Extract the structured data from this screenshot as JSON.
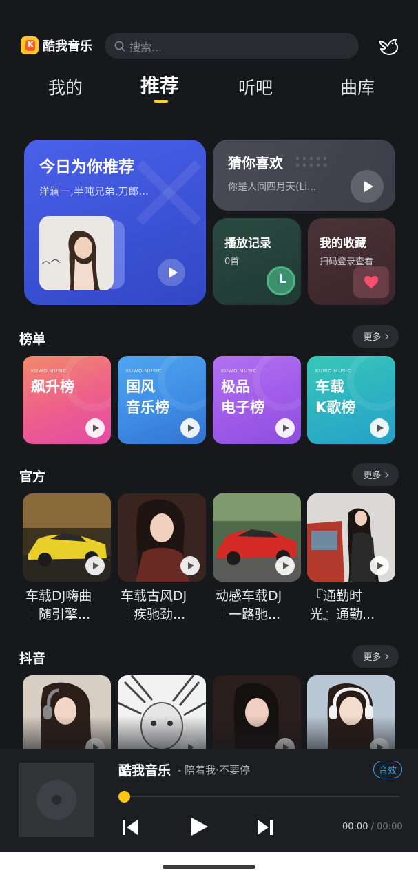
{
  "app": {
    "name": "酷我音乐"
  },
  "search": {
    "placeholder": "搜索..."
  },
  "tabs": [
    {
      "label": "我的"
    },
    {
      "label": "推荐"
    },
    {
      "label": "听吧"
    },
    {
      "label": "曲库"
    }
  ],
  "active_tab": "推荐",
  "feature": {
    "today": {
      "title": "今日为你推荐",
      "subtitle": "洋澜一,半吨兄弟,刀郎..."
    },
    "guess": {
      "title": "猜你喜欢",
      "subtitle": "你是人间四月天(Li..."
    },
    "history": {
      "title": "播放记录",
      "subtitle": "0首"
    },
    "favorites": {
      "title": "我的收藏",
      "subtitle": "扫码登录查看"
    }
  },
  "sections": {
    "charts": {
      "title": "榜单",
      "more": "更多"
    },
    "official": {
      "title": "官方",
      "more": "更多"
    },
    "douyin": {
      "title": "抖音",
      "more": "更多"
    }
  },
  "charts": [
    {
      "tag": "KUWO MUSIC",
      "name": "飙升榜"
    },
    {
      "tag": "KUWO MUSIC",
      "name": "国风\n音乐榜"
    },
    {
      "tag": "KUWO MUSIC",
      "name": "极品\n电子榜"
    },
    {
      "tag": "KUWO MUSIC",
      "name": "车载\nK歌榜"
    }
  ],
  "official_playlists": [
    {
      "title": "车载DJ嗨曲\n｜随引擎..."
    },
    {
      "title": "车载古风DJ\n｜疾驰劲..."
    },
    {
      "title": "动感车载DJ\n｜一路驰..."
    },
    {
      "title": "『通勤时\n光』通勤..."
    }
  ],
  "player": {
    "title": "酷我音乐",
    "subtitle": "- 陪着我·不要停",
    "effect_label": "音效",
    "current_time": "00:00",
    "separator": "/",
    "total_time": "00:00",
    "progress": 0
  },
  "colors": {
    "background": "#17181c",
    "accent_yellow": "#ffd21e",
    "effect_blue": "#3aa7f0"
  },
  "icons": {
    "logo": "kuwo-logo-icon",
    "search": "search-icon",
    "bird": "bird-icon",
    "play": "play-icon",
    "clock": "clock-icon",
    "heart": "heart-icon",
    "prev": "previous-icon",
    "next": "next-icon"
  }
}
